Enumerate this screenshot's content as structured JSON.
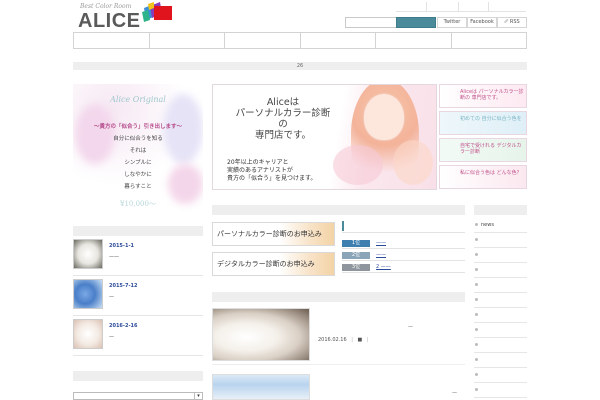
{
  "header": {
    "logo_tagline": "Best Color Room",
    "logo_name": "ALICE",
    "social": [
      "Twitter",
      "Facebook",
      "RSS"
    ],
    "accent": "#4a8a9a"
  },
  "slider_bar": {
    "label": "26"
  },
  "promo": {
    "title": "Alice Original",
    "lines": [
      "〜貴方の「似合う」引き出します〜",
      "自分に似合うを知る",
      "それは",
      "シンプルに",
      "しなやかに",
      "暮らすこと"
    ],
    "price": "¥10,000〜"
  },
  "banner": {
    "headline_lines": [
      "Aliceは",
      "パーソナルカラー診断の",
      "専門店です。"
    ],
    "sub_lines": [
      "20年以上のキャリアと",
      "実績のあるアナリストが",
      "貴方の「似合う」を見つけます。"
    ]
  },
  "side_thumbs": [
    {
      "text": "Aliceは パーソナルカラー診断の 専門店です。"
    },
    {
      "text": "初めての 自分に似合う色を"
    },
    {
      "text": "自宅で受けれる デジタルカラー診断"
    },
    {
      "text": "私に似合う色は どんな色？"
    }
  ],
  "recent_posts": [
    {
      "date": "2015-1-1",
      "excerpt": "——"
    },
    {
      "date": "2015-7-12",
      "excerpt": "—"
    },
    {
      "date": "2016-2-16",
      "excerpt": "—"
    }
  ],
  "cta_buttons": [
    "パーソナルカラー診断のお申込み",
    "デジタルカラー診断のお申込み"
  ],
  "ranking": [
    {
      "badge": "1位",
      "text": "——",
      "color": "#3e7fb0"
    },
    {
      "badge": "2位",
      "text": "——",
      "color": "#8aa4b8"
    },
    {
      "badge": "3位",
      "text": "2 ——",
      "color": "#8e959c"
    }
  ],
  "post": {
    "date": "2016.02.16",
    "sep": "|",
    "cat": "■",
    "sep2": "|",
    "dash": "—"
  },
  "categories": [
    "news"
  ]
}
